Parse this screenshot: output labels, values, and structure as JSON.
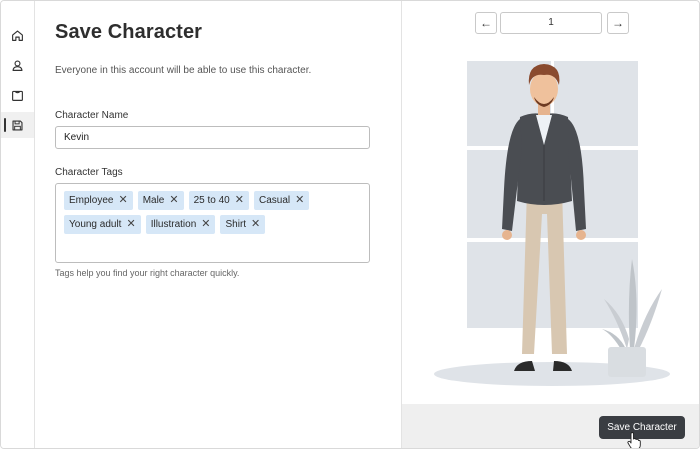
{
  "rail": {
    "items": [
      {
        "name": "home-icon"
      },
      {
        "name": "user-icon"
      },
      {
        "name": "tshirt-icon"
      },
      {
        "name": "save-icon",
        "active": true
      }
    ]
  },
  "form": {
    "title": "Save Character",
    "subtitle": "Everyone in this account will be able to use this character.",
    "name_label": "Character Name",
    "name_value": "Kevin",
    "tags_label": "Character Tags",
    "tags_row1": [
      "Employee",
      "Male",
      "25 to 40",
      "Casual"
    ],
    "tags_row2": [
      "Young adult",
      "Illustration",
      "Shirt"
    ],
    "tag_remove_glyph": "✕",
    "tags_hint": "Tags help you find your right character quickly."
  },
  "preview": {
    "prev_glyph": "←",
    "next_glyph": "→",
    "page_value": "1",
    "save_label": "Save Character"
  },
  "colors": {
    "accent_dark": "#3a3d42",
    "tag_bg": "#d6e7f7",
    "backdrop": "#dfe3e8"
  }
}
